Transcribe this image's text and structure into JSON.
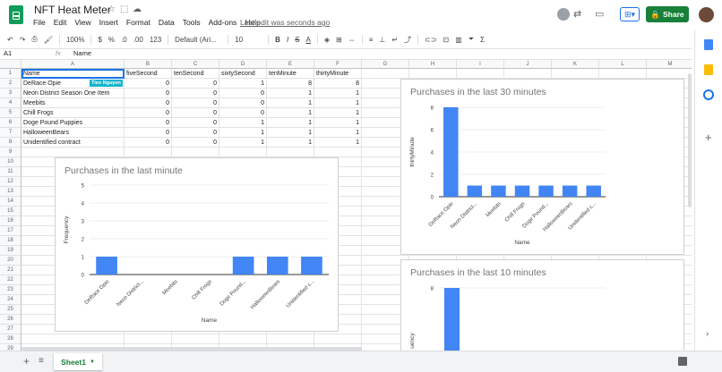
{
  "app": {
    "title": "NFT Heat Meter",
    "menus": [
      "File",
      "Edit",
      "View",
      "Insert",
      "Format",
      "Data",
      "Tools",
      "Add-ons",
      "Help"
    ],
    "last_edit": "Last edit was seconds ago",
    "share_label": "Share",
    "brand_color": "#0f9d58",
    "share_color": "#188038"
  },
  "toolbar": {
    "zoom": "100%",
    "currency": "$",
    "percent": "%",
    "dec_less": ".0",
    "dec_more": ".00",
    "format": "123",
    "font": "Default (Ari...",
    "font_size": "10",
    "bold": "B",
    "italic": "I",
    "strike": "S",
    "text_color": "A"
  },
  "formula": {
    "cell_ref": "A1",
    "fx": "fx",
    "value": "Name"
  },
  "columns": [
    "A",
    "B",
    "C",
    "D",
    "E",
    "F",
    "G",
    "H",
    "I",
    "J",
    "K",
    "L",
    "M"
  ],
  "rows": [
    "1",
    "2",
    "3",
    "4",
    "5",
    "6",
    "7",
    "8",
    "9",
    "10",
    "11",
    "12",
    "13",
    "14",
    "15",
    "16",
    "17",
    "18",
    "19",
    "20",
    "21",
    "22",
    "23",
    "24",
    "25",
    "26",
    "27",
    "28",
    "29"
  ],
  "table": {
    "headers": [
      "Name",
      "fiveSecond",
      "tenSecond",
      "sixtySecond",
      "tenMinute",
      "thirtyMinute"
    ],
    "data": [
      [
        "DeRace Opie",
        "0",
        "0",
        "1",
        "8",
        "8"
      ],
      [
        "Neon District Season One Item",
        "0",
        "0",
        "0",
        "1",
        "1"
      ],
      [
        "Meebits",
        "0",
        "0",
        "0",
        "1",
        "1"
      ],
      [
        "Chill Frogs",
        "0",
        "0",
        "0",
        "1",
        "1"
      ],
      [
        "Doge Pound Puppies",
        "0",
        "0",
        "1",
        "1",
        "1"
      ],
      [
        "HalloweenBears",
        "0",
        "0",
        "1",
        "1",
        "1"
      ],
      [
        "Unidentified contract",
        "0",
        "0",
        "1",
        "1",
        "1"
      ]
    ]
  },
  "collaborator_tag": "Tien Nguyen",
  "sheet": {
    "tab": "Sheet1"
  },
  "chart_data": [
    {
      "type": "bar",
      "title": "Purchases in the last minute",
      "xlabel": "Name",
      "ylabel": "Frequency",
      "categories": [
        "DeRace Opie",
        "Neon District...",
        "Meebits",
        "Chill Frogs",
        "Doge Pound...",
        "HalloweenBears",
        "Unidentified c..."
      ],
      "values": [
        1,
        0,
        0,
        0,
        1,
        1,
        1
      ],
      "ylim": [
        0,
        5
      ],
      "yticks": [
        "0",
        "1",
        "2",
        "3",
        "4",
        "5"
      ],
      "color": "#4285f4"
    },
    {
      "type": "bar",
      "title": "Purchases in the last 30 minutes",
      "xlabel": "Name",
      "ylabel": "thirtyMinute",
      "categories": [
        "DeRace Opie",
        "Neon District...",
        "Meebits",
        "Chill Frogs",
        "Doge Pound...",
        "HalloweenBears",
        "Unidentified c..."
      ],
      "values": [
        8,
        1,
        1,
        1,
        1,
        1,
        1
      ],
      "ylim": [
        0,
        8
      ],
      "yticks": [
        "0",
        "2",
        "4",
        "6",
        "8"
      ],
      "color": "#4285f4"
    },
    {
      "type": "bar",
      "title": "Purchases in the last 10 minutes",
      "ylabel_visible": "uency",
      "yticks": [
        "8"
      ],
      "values": [
        8
      ],
      "color": "#4285f4"
    }
  ]
}
